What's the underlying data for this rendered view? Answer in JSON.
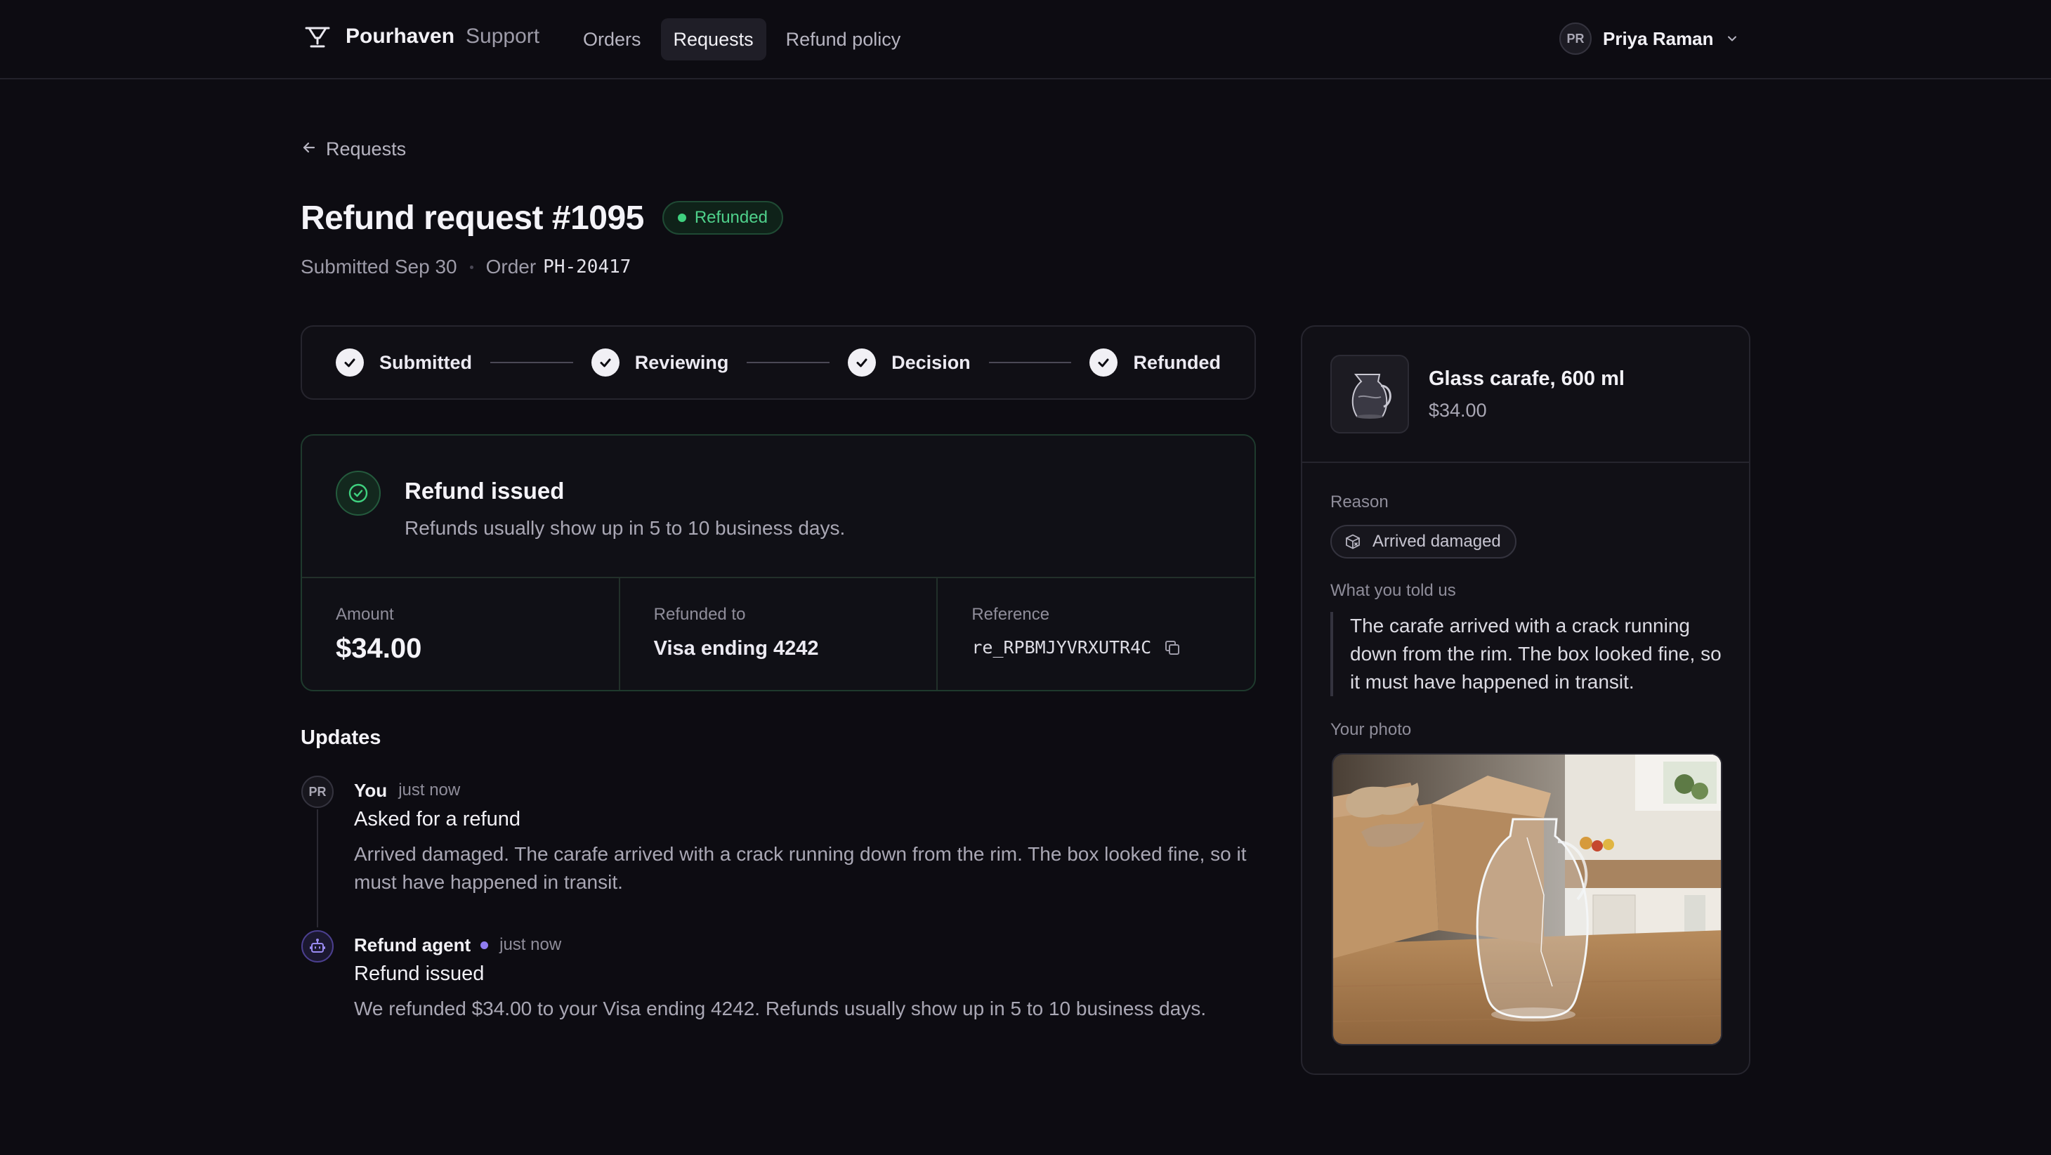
{
  "header": {
    "brand_name": "Pourhaven",
    "brand_sub": "Support",
    "nav": [
      {
        "label": "Orders"
      },
      {
        "label": "Requests"
      },
      {
        "label": "Refund policy"
      }
    ],
    "active_nav": "Requests",
    "user": {
      "initials": "PR",
      "name": "Priya Raman"
    }
  },
  "back_label": "Requests",
  "page": {
    "title": "Refund request #1095",
    "status": "Refunded",
    "submitted": "Submitted Sep 30",
    "order_label": "Order",
    "order_code": "PH-20417"
  },
  "stepper": {
    "steps": [
      {
        "label": "Submitted",
        "done": true
      },
      {
        "label": "Reviewing",
        "done": true
      },
      {
        "label": "Decision",
        "done": true
      },
      {
        "label": "Refunded",
        "done": true
      }
    ]
  },
  "refund": {
    "title": "Refund issued",
    "subtitle": "Refunds usually show up in 5 to 10 business days.",
    "amount_label": "Amount",
    "amount": "$34.00",
    "refunded_to_label": "Refunded to",
    "refunded_to": "Visa ending 4242",
    "reference_label": "Reference",
    "reference": "re_RPBMJYVRXUTR4C"
  },
  "updates": {
    "title": "Updates",
    "items": [
      {
        "author": "You",
        "initials": "PR",
        "time": "just now",
        "title": "Asked for a refund",
        "body": "Arrived damaged. The carafe arrived with a crack running down from the rim. The box looked fine, so it must have happened in transit."
      },
      {
        "author": "Refund agent",
        "time": "just now",
        "title": "Refund issued",
        "body": "We refunded $34.00 to your Visa ending 4242. Refunds usually show up in 5 to 10 business days."
      }
    ]
  },
  "side": {
    "product_name": "Glass carafe, 600 ml",
    "product_price": "$34.00",
    "reason_label": "Reason",
    "reason": "Arrived damaged",
    "told_label": "What you told us",
    "told": "The carafe arrived with a crack running down from the rim. The box looked fine, so it must have happened in transit.",
    "photo_label": "Your photo"
  },
  "colors": {
    "background": "#0d0c12",
    "success": "#4fd18b",
    "agent_accent": "#8f7cf0"
  }
}
